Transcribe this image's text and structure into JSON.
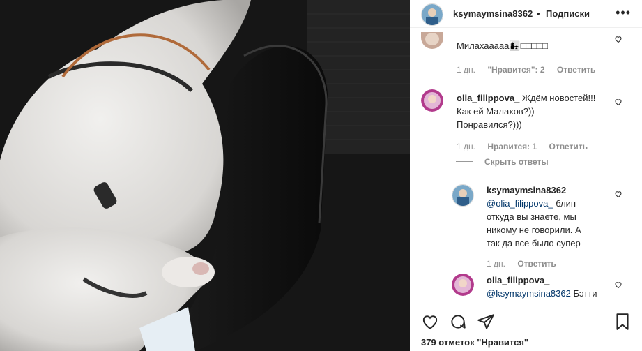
{
  "header": {
    "username": "ksymaymsina8362",
    "dot": "•",
    "follow_label": "Подписки",
    "more_icon": "more-icon"
  },
  "comments": [
    {
      "username": "",
      "text": "Милахааааа👩‍👧□□□□□",
      "age": "1 дн.",
      "likes": "\"Нравится\": 2",
      "reply": "Ответить"
    },
    {
      "username": "olia_filippova_",
      "text_lines": [
        "Ждём новостей!!!",
        "Как ей Малахов?))",
        "Понравился?)))"
      ],
      "age": "1 дн.",
      "likes": "Нравится: 1",
      "reply": "Ответить",
      "hide_replies": "Скрыть ответы",
      "replies": [
        {
          "username": "ksymaymsina8362",
          "mention": "@olia_filippova_",
          "text_lines": [
            "блин",
            "откуда вы знаете, мы",
            "никому не говорили. А",
            "так да все было супер"
          ],
          "age": "1 дн.",
          "reply": "Ответить"
        },
        {
          "username": "olia_filippova_",
          "mention": "@ksymaymsina8362",
          "text": "Бэтти"
        }
      ]
    }
  ],
  "actions": {
    "like_icon": "heart-icon",
    "comment_icon": "comment-icon",
    "share_icon": "share-icon",
    "save_icon": "bookmark-icon",
    "likes_count": "379 отметок \"Нравится\""
  }
}
